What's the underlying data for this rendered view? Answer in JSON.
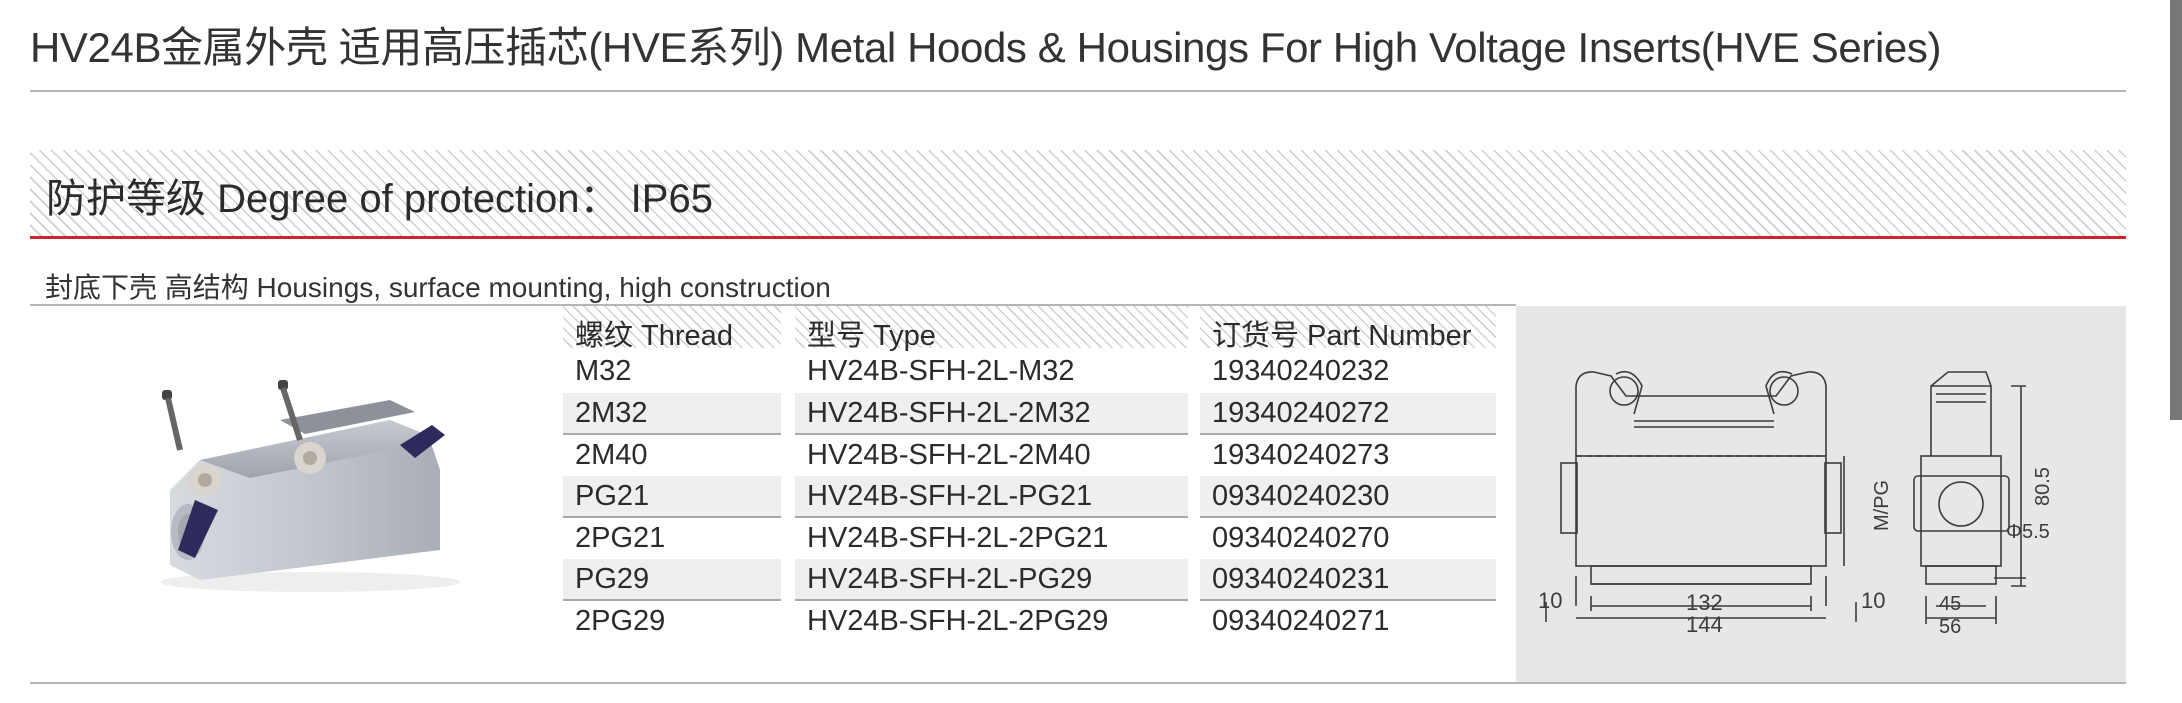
{
  "title": "HV24B金属外壳  适用高压插芯(HVE系列)  Metal Hoods & Housings For High Voltage Inserts(HVE Series)",
  "protection": "防护等级 Degree of protection：  IP65",
  "subtitle": "封底下壳 高结构 Housings, surface mounting, high construction",
  "table": {
    "headers": [
      "螺纹 Thread",
      "型号 Type",
      "订货号 Part Number"
    ],
    "rows": [
      {
        "thread": "M32",
        "type": "HV24B-SFH-2L-M32",
        "part": "19340240232"
      },
      {
        "thread": "2M32",
        "type": "HV24B-SFH-2L-2M32",
        "part": "19340240272"
      },
      {
        "thread": "2M40",
        "type": "HV24B-SFH-2L-2M40",
        "part": "19340240273"
      },
      {
        "thread": "PG21",
        "type": "HV24B-SFH-2L-PG21",
        "part": "09340240230"
      },
      {
        "thread": "2PG21",
        "type": "HV24B-SFH-2L-2PG21",
        "part": "09340240270"
      },
      {
        "thread": "PG29",
        "type": "HV24B-SFH-2L-PG29",
        "part": "09340240231"
      },
      {
        "thread": "2PG29",
        "type": "HV24B-SFH-2L-2PG29",
        "part": "09340240271"
      }
    ]
  },
  "drawing": {
    "dims": {
      "d132": "132",
      "d144": "144",
      "d10_left": "10",
      "d10_right": "10",
      "thread_label": "M/PG",
      "d80_5": "80.5",
      "d5_5": "Φ5.5",
      "d45": "45",
      "d56": "56"
    }
  },
  "colors": {
    "accent_red": "#c9272d",
    "rule_gray": "#b5b5b5",
    "drawing_bg": "#e7e7e8"
  }
}
